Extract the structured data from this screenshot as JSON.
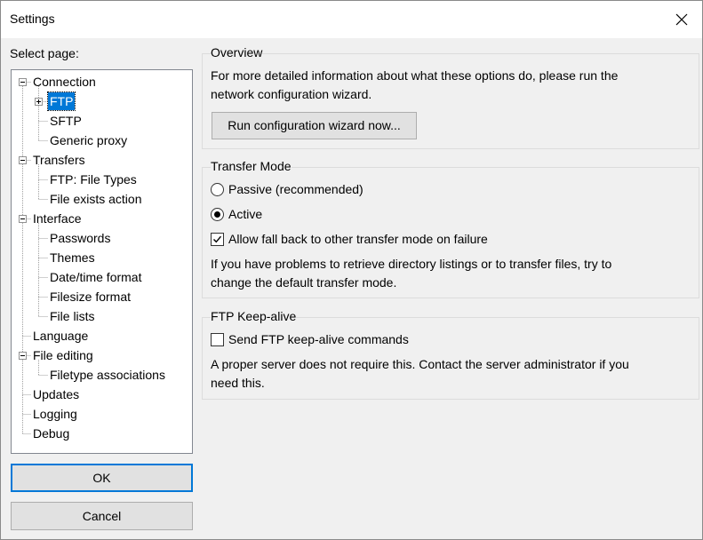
{
  "window": {
    "title": "Settings"
  },
  "sidebar": {
    "label": "Select page:",
    "tree": [
      "Connection",
      "FTP",
      "SFTP",
      "Generic proxy",
      "Transfers",
      "FTP: File Types",
      "File exists action",
      "Interface",
      "Passwords",
      "Themes",
      "Date/time format",
      "Filesize format",
      "File lists",
      "Language",
      "File editing",
      "Filetype associations",
      "Updates",
      "Logging",
      "Debug"
    ],
    "selected": "FTP"
  },
  "buttons": {
    "ok": "OK",
    "cancel": "Cancel"
  },
  "overview": {
    "title": "Overview",
    "line1": "For more detailed information about what these options do, please run the",
    "line2": "network configuration wizard.",
    "wizard_button": "Run configuration wizard now..."
  },
  "transfer_mode": {
    "title": "Transfer Mode",
    "passive": "Passive (recommended)",
    "active": "Active",
    "selected": "Active",
    "fallback": "Allow fall back to other transfer mode on failure",
    "fallback_checked": true,
    "hint1": "If you have problems to retrieve directory listings or to transfer files, try to",
    "hint2": "change the default transfer mode."
  },
  "keepalive": {
    "title": "FTP Keep-alive",
    "send": "Send FTP keep-alive commands",
    "send_checked": false,
    "note1": "A proper server does not require this. Contact the server administrator if you",
    "note2": "need this."
  }
}
